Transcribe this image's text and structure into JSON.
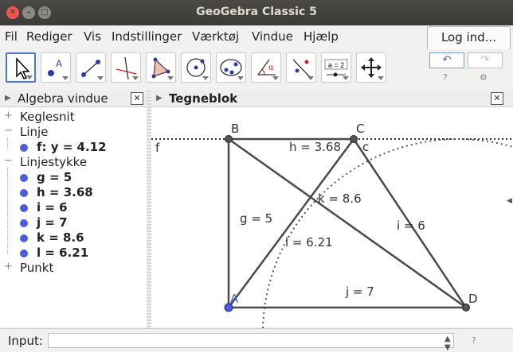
{
  "window": {
    "title": "GeoGebra Classic 5"
  },
  "menu": {
    "items": [
      "Fil",
      "Rediger",
      "Vis",
      "Indstillinger",
      "Værktøj",
      "Vindue",
      "Hjælp"
    ],
    "login_label": "Log ind..."
  },
  "toolbar": {
    "tools": [
      "move-tool-icon",
      "point-tool-icon",
      "line-tool-icon",
      "perpendicular-tool-icon",
      "polygon-tool-icon",
      "circle-tool-icon",
      "conic-tool-icon",
      "angle-tool-icon",
      "reflect-tool-icon",
      "slider-tool-icon",
      "move-graphics-tool-icon"
    ],
    "slider_text": "a = 2",
    "angle_text": "α",
    "point_text": "A",
    "undo": "↶",
    "redo": "↷"
  },
  "algebra": {
    "title": "Algebra vindue",
    "groups": [
      {
        "label": "Keglesnit",
        "toggle": "+",
        "items": []
      },
      {
        "label": "Linje",
        "toggle": "−",
        "items": [
          "f: y = 4.12"
        ]
      },
      {
        "label": "Linjestykke",
        "toggle": "−",
        "items": [
          "g = 5",
          "h = 3.68",
          "i = 6",
          "j = 7",
          "k = 8.6",
          "l = 6.21"
        ]
      },
      {
        "label": "Punkt",
        "toggle": "+",
        "items": []
      }
    ]
  },
  "graphics": {
    "title": "Tegneblok",
    "points": {
      "A": "A",
      "B": "B",
      "C": "C",
      "D": "D"
    },
    "labels": {
      "f": "f",
      "c": "c",
      "h": "h = 3.68",
      "k": "k = 8.6",
      "g": "g = 5",
      "i": "i = 6",
      "l": "l = 6.21",
      "j": "j = 7"
    }
  },
  "input": {
    "label": "Input:",
    "value": ""
  },
  "colors": {
    "point_blue": "#4d5be0",
    "segment": "#4a4a4a",
    "active_tool": "#4d77c4"
  }
}
